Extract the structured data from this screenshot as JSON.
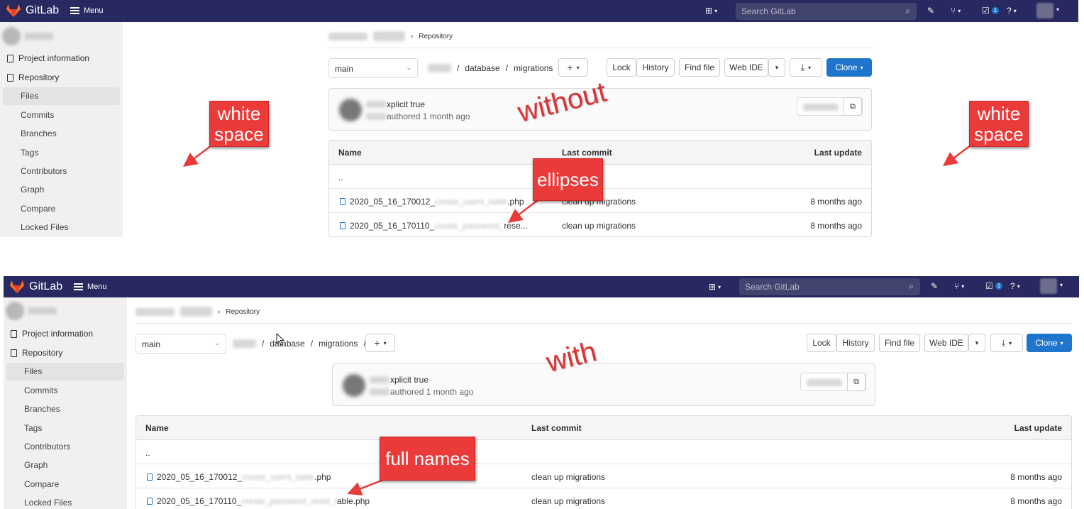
{
  "app": {
    "brand": "GitLab",
    "menu_label": "Menu",
    "search_placeholder": "Search GitLab",
    "todo_count": "1",
    "colors": {
      "navbar": "#292961",
      "primary": "#1f75cb",
      "callout": "#ea3a3a"
    }
  },
  "icons": [
    "gitlab-logo",
    "hamburger-icon",
    "plus-square-icon",
    "chevron-down-icon",
    "search-icon",
    "issues-icon",
    "merge-request-icon",
    "todo-icon",
    "help-icon",
    "user-avatar",
    "doc-icon",
    "file-icon",
    "copy-icon",
    "download-icon"
  ],
  "sidebar": {
    "items": [
      {
        "label": "Project information",
        "icon": "info-icon"
      },
      {
        "label": "Repository",
        "icon": "doc-icon"
      }
    ],
    "subitems": [
      "Files",
      "Commits",
      "Branches",
      "Tags",
      "Contributors",
      "Graph",
      "Compare",
      "Locked Files"
    ],
    "active": "Files"
  },
  "breadcrumb": {
    "current": "Repository"
  },
  "repo": {
    "branch": "main",
    "path_parts": [
      "database",
      "migrations"
    ],
    "path_sep": "/",
    "add_label": "+",
    "buttons": {
      "lock": "Lock",
      "history": "History",
      "find_file": "Find file",
      "web_ide": "Web IDE",
      "clone": "Clone"
    }
  },
  "commit": {
    "title_visible": "xplicit true",
    "meta_visible": "authored 1 month ago"
  },
  "table": {
    "headers": {
      "name": "Name",
      "last_commit": "Last commit",
      "last_update": "Last update"
    },
    "parent": "..",
    "top_rows": [
      {
        "name_prefix": "2020_05_16_170012_",
        "name_suffix": ".php",
        "commit": "clean up migrations",
        "updated": "8 months ago"
      },
      {
        "name_prefix": "2020_05_16_170110_",
        "name_suffix": "rese...",
        "commit": "clean up migrations",
        "updated": "8 months ago"
      }
    ],
    "bottom_rows": [
      {
        "name_prefix": "2020_05_16_170012_",
        "name_suffix": ".php",
        "commit": "clean up migrations",
        "updated": "8 months ago"
      },
      {
        "name_prefix": "2020_05_16_170110_",
        "name_suffix": "able.php",
        "commit": "clean up migrations",
        "updated": "8 months ago"
      }
    ]
  },
  "annotations": {
    "white_space_left": "white\nspace",
    "white_space_right": "white\nspace",
    "ellipses": "ellipses",
    "full_names": "full names",
    "without": "without",
    "with": "with"
  }
}
